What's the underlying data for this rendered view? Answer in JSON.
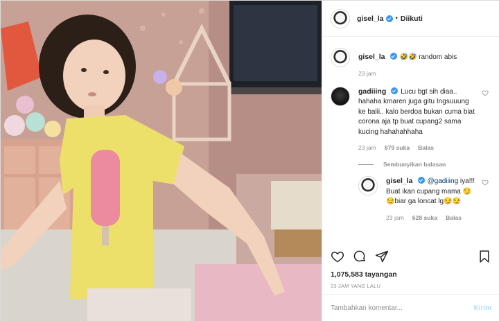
{
  "header": {
    "username": "gisel_la",
    "separator": "•",
    "follow_status": "Diikuti",
    "avatar_icon": "profile-avatar"
  },
  "caption": {
    "username": "gisel_la",
    "text": "🤣🤣 random abis",
    "time": "23 jam"
  },
  "comments": [
    {
      "username": "gadiiing",
      "text": "Lucu bgt sih diaa.. hahaha kmaren juga gitu Ingsuuung ke balii.. kalo berdoa bukan cuma biat corona aja tp buat cupang2 sama kucing hahahahhaha",
      "time": "23 jam",
      "likes": "879 suka",
      "reply_label": "Balas",
      "hide_replies_label": "Sembunyikan balasan",
      "replies": [
        {
          "username": "gisel_la",
          "mention": "@gadiiing",
          "text": " iya!!! Buat ikan cupang mama 😏😏biar ga loncat lg😏😏",
          "time": "23 jam",
          "likes": "628 suka",
          "reply_label": "Balas"
        }
      ]
    }
  ],
  "actions": {
    "views": "1,075,583 tayangan",
    "date": "23 JAM YANG LALU",
    "icons": [
      "heart-icon",
      "comment-icon",
      "share-icon",
      "bookmark-icon"
    ]
  },
  "add_comment": {
    "placeholder": "Tambahkan komentar...",
    "post_label": "Kirim"
  },
  "colors": {
    "verified": "#3897f0",
    "post_disabled": "#b2dffc",
    "muted": "#8e8e8e",
    "text": "#262626"
  }
}
